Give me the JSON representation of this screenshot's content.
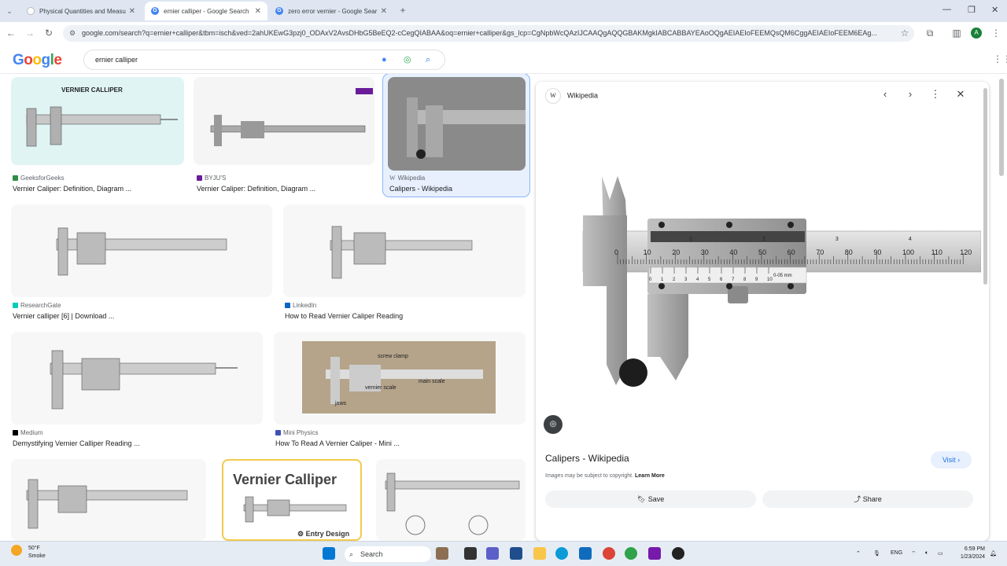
{
  "browser": {
    "tabs": [
      {
        "title": "Physical Quantities and Measu",
        "favicon": "doc-icon",
        "active": false
      },
      {
        "title": "ernier calliper - Google Search",
        "favicon": "google-icon",
        "active": true
      },
      {
        "title": "zero error vernier - Google Sear",
        "favicon": "google-icon",
        "active": false
      }
    ],
    "url": "google.com/search?q=ernier+calliper&tbm=isch&ved=2ahUKEwG3pzj0_ODAxV2AvsDHbG5BeEQ2-cCegQIABAA&oq=ernier+calliper&gs_lcp=CgNpbWcQAzIJCAAQgAQQGBAKMgkIABCABBAYEAoOQgAEIAEIoFEEMQsQM6CggAEIAEIoFEEM6EAg...",
    "profile_initial": "A"
  },
  "google": {
    "logo_letters": [
      "G",
      "o",
      "o",
      "g",
      "l",
      "e"
    ],
    "query": "ernier calliper"
  },
  "results": [
    {
      "source": "GeeksforGeeks",
      "title": "Vernier Caliper: Definition, Diagram ...",
      "thumb_heading": "VERNIER CALLIPER",
      "thumb_bg": "#e0f4f4"
    },
    {
      "source": "BYJU'S",
      "title": "Vernier Caliper: Definition, Diagram ...",
      "thumb_heading": "",
      "thumb_bg": "#f5f5f5"
    },
    {
      "source": "Wikipedia",
      "title": "Calipers - Wikipedia",
      "thumb_heading": "",
      "thumb_bg": "#8a8a8a"
    },
    {
      "source": "ResearchGate",
      "title": "Vernier calliper [6] | Download ...",
      "thumb_heading": "",
      "thumb_bg": "#f7f7f7"
    },
    {
      "source": "LinkedIn",
      "title": "How to Read Vernier Caliper Reading",
      "thumb_heading": "",
      "thumb_bg": "#f7f7f7"
    },
    {
      "source": "Medium",
      "title": "Demystifying Vernier Calliper Reading ...",
      "thumb_heading": "",
      "thumb_bg": "#f7f7f7"
    },
    {
      "source": "Mini Physics",
      "title": "How To Read A Vernier Caliper - Mini ...",
      "thumb_heading": "",
      "thumb_bg": "#b5a48a"
    },
    {
      "source": "",
      "title": "",
      "thumb_heading": "",
      "thumb_bg": "#f7f7f7"
    },
    {
      "source": "",
      "title": "",
      "thumb_heading": "Vernier Calliper",
      "thumb_bg": "#ffffff"
    },
    {
      "source": "",
      "title": "",
      "thumb_heading": "",
      "thumb_bg": "#f7f7f7"
    }
  ],
  "thumb_labels": {
    "minib_screw": "screw clamp",
    "minib_main": "main scale",
    "minib_vernier": "vernier scale",
    "minib_jaws": "jaws",
    "ed_brand": "Entry Design"
  },
  "panel": {
    "site": "Wikipedia",
    "title": "Calipers - Wikipedia",
    "visit_label": "Visit",
    "copyright": "Images may be subject to copyright.",
    "learn_more": "Learn More",
    "save_label": "Save",
    "share_label": "Share",
    "main_scale_ticks": [
      "0",
      "10",
      "20",
      "30",
      "40",
      "50",
      "60",
      "70",
      "80",
      "90",
      "100",
      "110",
      "120"
    ],
    "upper_ticks": [
      "1",
      "2",
      "3",
      "4"
    ],
    "vernier_ticks": [
      "0",
      "1",
      "2",
      "3",
      "4",
      "5",
      "6",
      "7",
      "8",
      "9",
      "10"
    ],
    "vernier_note": "0-05 mm"
  },
  "taskbar": {
    "temp": "50°F",
    "condition": "Smoke",
    "search_placeholder": "Search",
    "lang": "ENG",
    "time": "6:59 PM",
    "date": "1/23/2024"
  }
}
